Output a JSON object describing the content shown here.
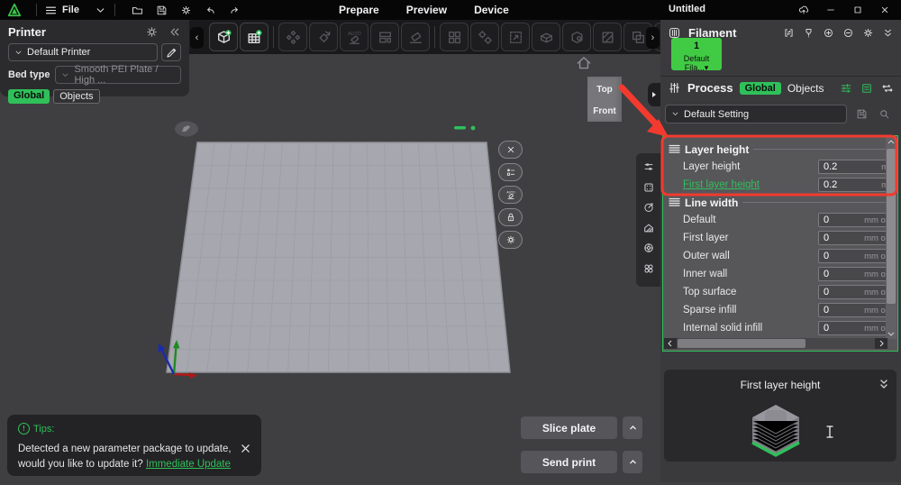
{
  "titlebar": {
    "file_label": "File",
    "tool_icons": [
      "folder-open-icon",
      "save-icon",
      "gear-icon",
      "undo-icon",
      "redo-icon"
    ],
    "tabs": [
      {
        "label": "Prepare"
      },
      {
        "label": "Preview"
      },
      {
        "label": "Device"
      }
    ],
    "document_title": "Untitled",
    "window_icons": [
      "cloud-upload-icon",
      "minimize-icon",
      "maximize-icon",
      "close-icon"
    ]
  },
  "toolbar": {
    "buttons": [
      {
        "name": "add-model-icon",
        "enabled": true
      },
      {
        "name": "add-plate-icon",
        "enabled": true
      },
      {
        "divider": true
      },
      {
        "name": "arrange-icon",
        "enabled": false
      },
      {
        "name": "rotate-icon",
        "enabled": false
      },
      {
        "name": "auto-orient-icon",
        "enabled": false
      },
      {
        "name": "split-icon",
        "enabled": false
      },
      {
        "name": "lay-flat-icon",
        "enabled": false
      },
      {
        "divider": true
      },
      {
        "name": "assembly-icon",
        "enabled": false
      },
      {
        "name": "variable-gears-icon",
        "enabled": false
      },
      {
        "name": "scale-icon",
        "enabled": false
      },
      {
        "name": "support-box-icon",
        "enabled": false
      },
      {
        "name": "primitive-icon",
        "enabled": false
      },
      {
        "name": "hatch-icon",
        "enabled": false
      },
      {
        "name": "boolean-icon",
        "enabled": false
      },
      {
        "name": "mesh-edit-icon",
        "enabled": false
      }
    ]
  },
  "printer_panel": {
    "title": "Printer",
    "printer_select": "Default Printer",
    "bed_type_label": "Bed type",
    "bed_type_value": "Smooth PEI Plate / High ...",
    "tabs": [
      {
        "label": "Global",
        "active": true
      },
      {
        "label": "Objects",
        "active": false
      }
    ]
  },
  "viewcube": {
    "top_label": "Top",
    "front_label": "Front"
  },
  "viewport_buttons": [
    "close-icon",
    "objects-list-icon",
    "auto-stamp-icon",
    "lock-icon",
    "gear-icon"
  ],
  "category_strip": [
    "quality-sliders-icon",
    "strength-dots-icon",
    "speed-gauge-icon",
    "support-house-icon",
    "others-wheel-icon",
    "advanced-clover-icon"
  ],
  "filament_panel": {
    "title": "Filament",
    "header_icons": [
      "sync-mapping-icon",
      "nozzle-icon",
      "plus-circle-icon",
      "minus-circle-icon",
      "gear-icon",
      "double-chevron-down-icon"
    ],
    "slot_number": "1",
    "slot_label": "Default Fila..."
  },
  "process_panel": {
    "title": "Process",
    "tabs": [
      {
        "label": "Global",
        "active": true
      },
      {
        "label": "Objects",
        "active": false
      }
    ],
    "header_icons": [
      "filter-sliders-icon",
      "doc-list-icon",
      "swap-flow-icon"
    ],
    "preset_value": "Default Setting",
    "preset_icons": [
      "save-icon",
      "search-icon"
    ],
    "sections": [
      {
        "title": "Layer height",
        "icon": "layers-icon",
        "rows": [
          {
            "label": "Layer height",
            "value": "0.2",
            "unit": "m",
            "highlighted": false
          },
          {
            "label": "First layer height",
            "value": "0.2",
            "unit": "m",
            "highlighted": true
          }
        ]
      },
      {
        "title": "Line width",
        "icon": "layers-gray-icon",
        "rows": [
          {
            "label": "Default",
            "value": "0",
            "unit": "mm or",
            "highlighted": false
          },
          {
            "label": "First layer",
            "value": "0",
            "unit": "mm or",
            "highlighted": false
          },
          {
            "label": "Outer wall",
            "value": "0",
            "unit": "mm or",
            "highlighted": false
          },
          {
            "label": "Inner wall",
            "value": "0",
            "unit": "mm or",
            "highlighted": false
          },
          {
            "label": "Top surface",
            "value": "0",
            "unit": "mm or",
            "highlighted": false
          },
          {
            "label": "Sparse infill",
            "value": "0",
            "unit": "mm or",
            "highlighted": false
          },
          {
            "label": "Internal solid infill",
            "value": "0",
            "unit": "mm or",
            "highlighted": false
          }
        ]
      }
    ]
  },
  "tooltip_card": {
    "title": "First layer height"
  },
  "tips_toast": {
    "title": "Tips:",
    "message": "Detected a new parameter package to update, would you like to update it? ",
    "link_label": "Immediate Update"
  },
  "action_buttons": {
    "slice_label": "Slice plate",
    "send_label": "Send print"
  },
  "colors": {
    "accent_green": "#2fc05a",
    "filament_green": "#41cb45",
    "annotation_red": "#f23a2e"
  }
}
